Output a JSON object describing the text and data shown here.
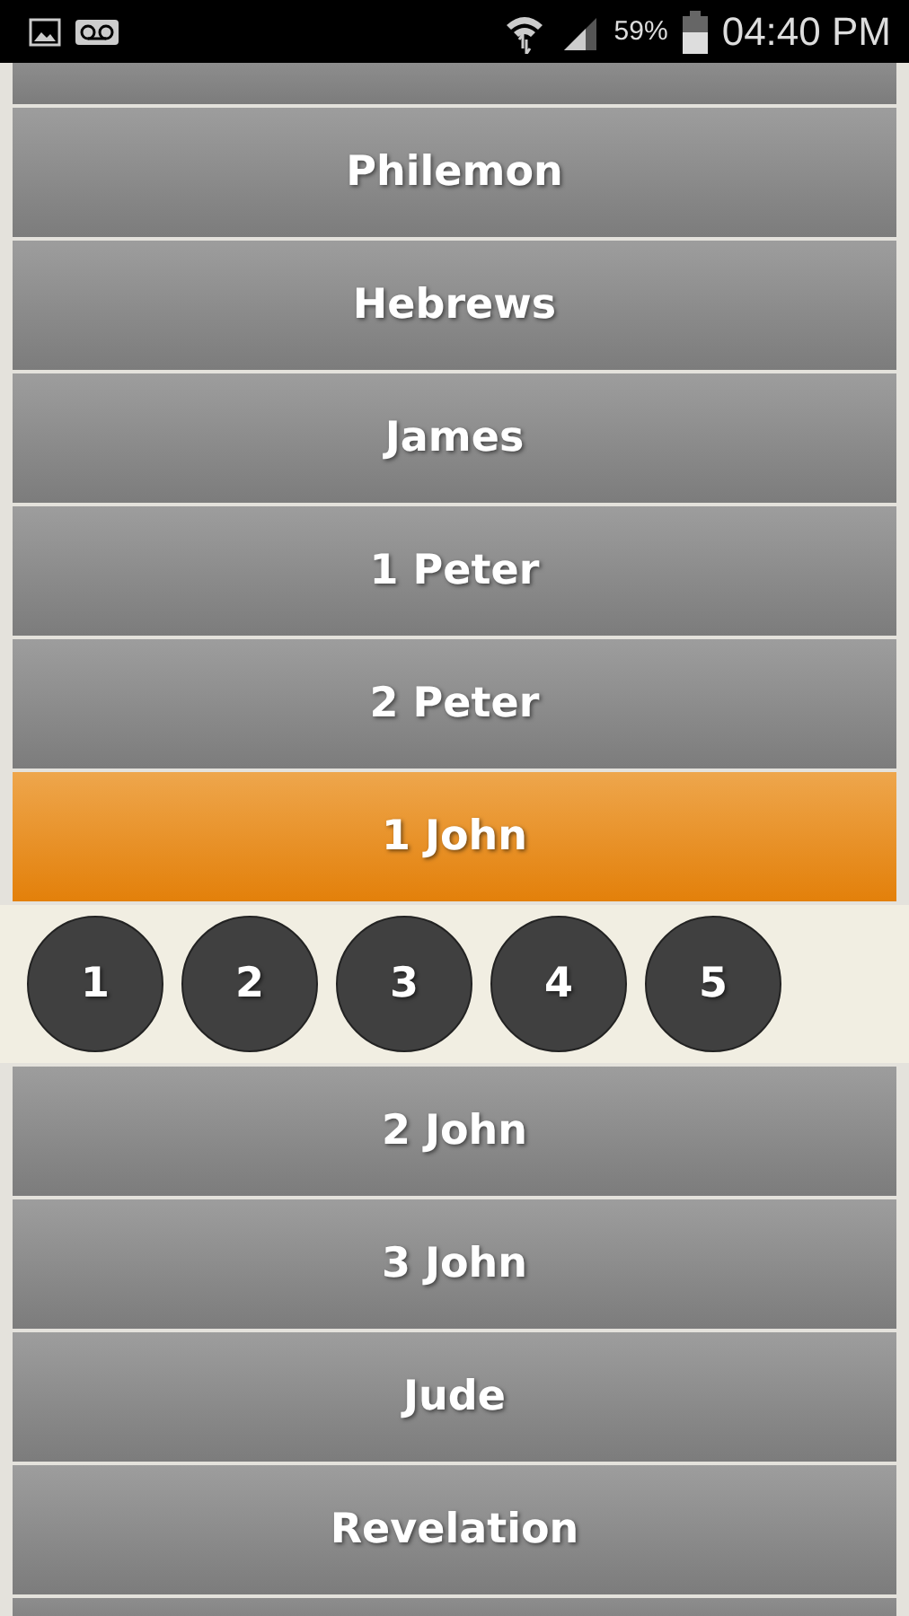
{
  "status_bar": {
    "battery": "59%",
    "time": "04:40 PM"
  },
  "books": [
    {
      "name": "Philemon",
      "selected": false
    },
    {
      "name": "Hebrews",
      "selected": false
    },
    {
      "name": "James",
      "selected": false
    },
    {
      "name": "1 Peter",
      "selected": false
    },
    {
      "name": "2 Peter",
      "selected": false
    },
    {
      "name": "1 John",
      "selected": true,
      "chapters": [
        "1",
        "2",
        "3",
        "4",
        "5"
      ]
    },
    {
      "name": "2 John",
      "selected": false
    },
    {
      "name": "3 John",
      "selected": false
    },
    {
      "name": "Jude",
      "selected": false
    },
    {
      "name": "Revelation",
      "selected": false
    }
  ]
}
